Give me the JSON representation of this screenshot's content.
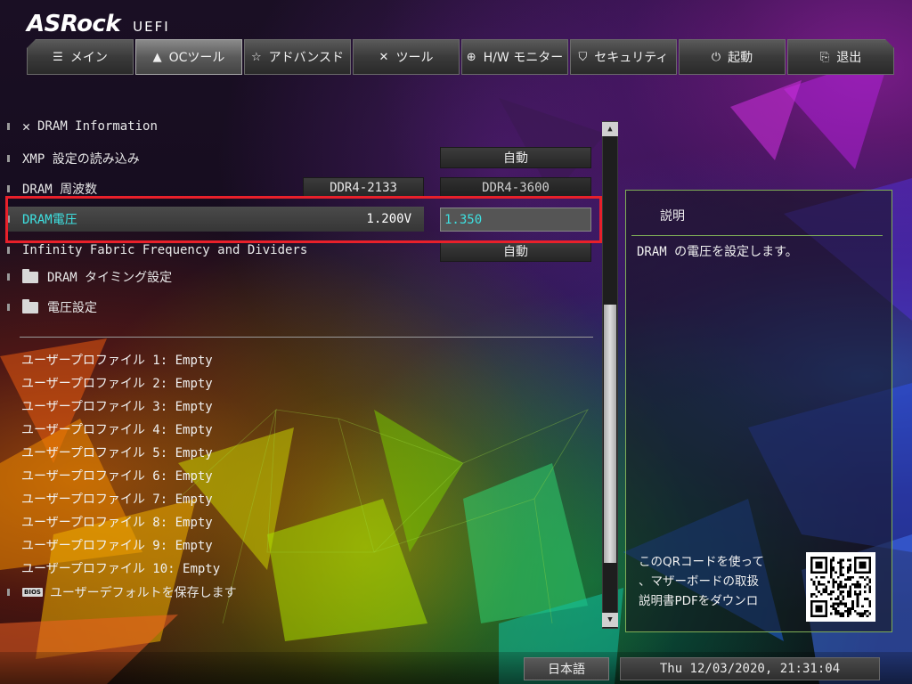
{
  "header": {
    "brand": "ASRock",
    "subtitle": "UEFI"
  },
  "tabs": [
    {
      "label": "メイン",
      "icon": "list-icon"
    },
    {
      "label": "OCツール",
      "icon": "rocket-icon"
    },
    {
      "label": "アドバンスド",
      "icon": "star-icon"
    },
    {
      "label": "ツール",
      "icon": "tools-icon"
    },
    {
      "label": "H/W モニター",
      "icon": "globe-icon"
    },
    {
      "label": "セキュリティ",
      "icon": "shield-icon"
    },
    {
      "label": "起動",
      "icon": "power-icon"
    },
    {
      "label": "退出",
      "icon": "exit-icon"
    }
  ],
  "active_tab": "OCツール",
  "menu": {
    "dram_info": "DRAM Information",
    "xmp_label": "XMP 設定の読み込み",
    "xmp_value": "自動",
    "freq_label": "DRAM 周波数",
    "freq_current": "DDR4-2133",
    "freq_value": "DDR4-3600",
    "voltage_label": "DRAM電圧",
    "voltage_current": "1.200V",
    "voltage_value": "1.350",
    "infinity_label": "Infinity Fabric Frequency and Dividers",
    "infinity_value": "自動",
    "timing_label": "DRAM タイミング設定",
    "voltage_settings_label": "電圧設定"
  },
  "profiles": [
    "ユーザープロファイル 1: Empty",
    "ユーザープロファイル 2: Empty",
    "ユーザープロファイル 3: Empty",
    "ユーザープロファイル 4: Empty",
    "ユーザープロファイル 5: Empty",
    "ユーザープロファイル 6: Empty",
    "ユーザープロファイル 7: Empty",
    "ユーザープロファイル 8: Empty",
    "ユーザープロファイル 9: Empty",
    "ユーザープロファイル 10: Empty"
  ],
  "save_default": {
    "badge": "BIOS",
    "label": "ユーザーデフォルトを保存します"
  },
  "description": {
    "title": "説明",
    "text": "DRAM の電圧を設定します。",
    "qr_text": "このQRコードを使って\n、マザーボードの取扱\n説明書PDFをダウンロ"
  },
  "footer": {
    "language": "日本語",
    "datetime": "Thu 12/03/2020, 21:31:04"
  },
  "colors": {
    "highlight": "#e8202a",
    "selected_text": "#3ee0e0",
    "panel_border": "#7fae57"
  }
}
